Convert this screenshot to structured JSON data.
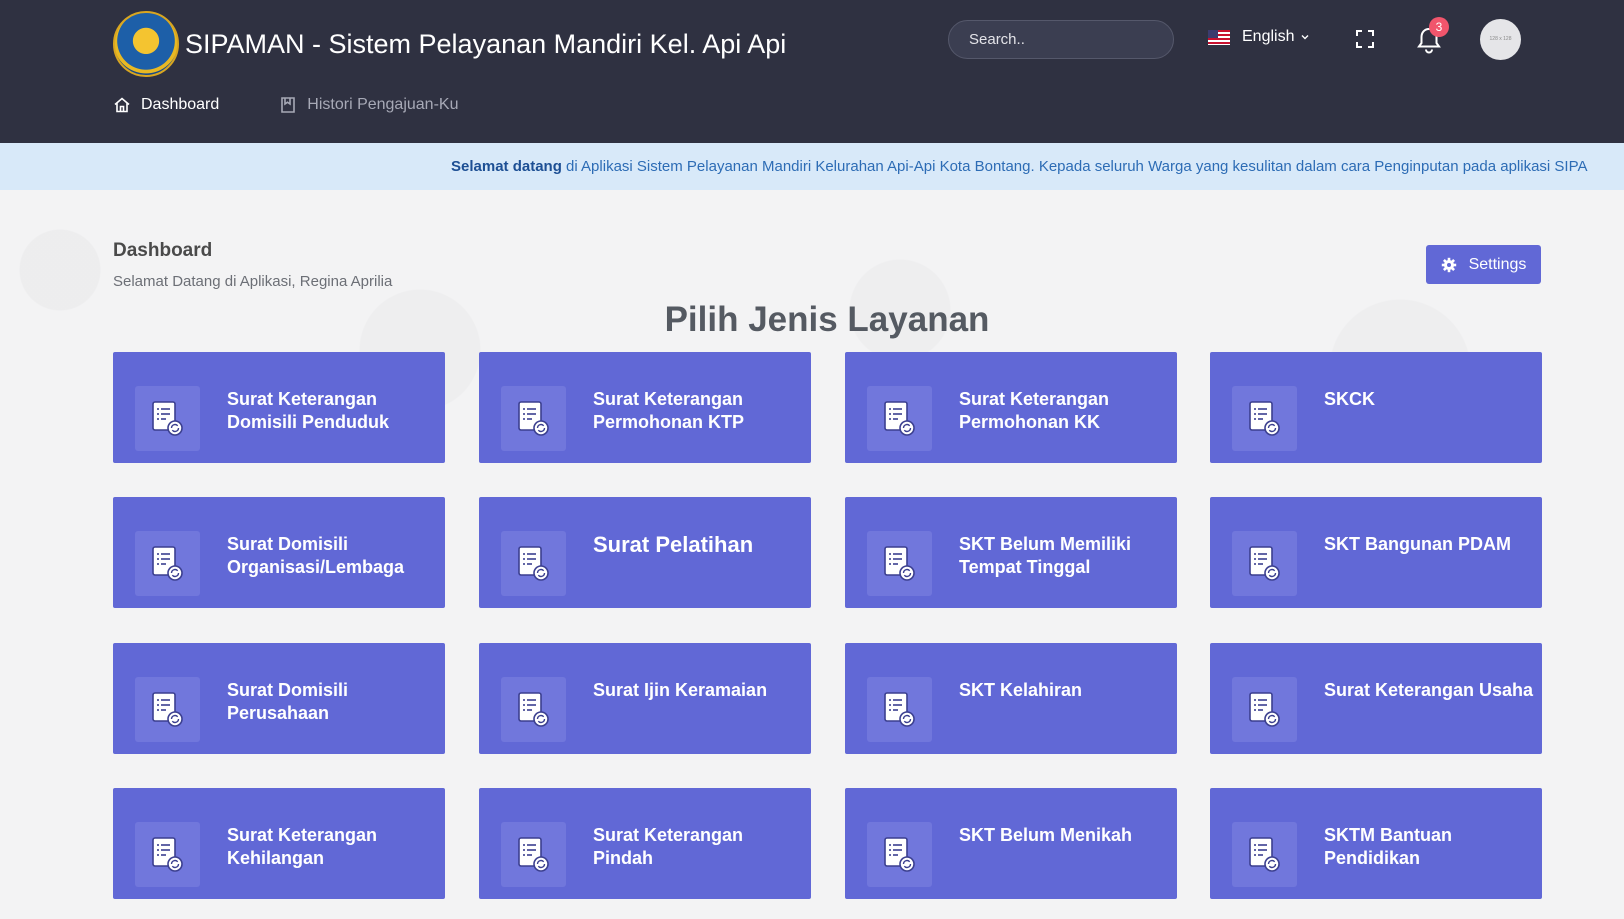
{
  "header": {
    "title": "SIPAMAN - Sistem Pelayanan Mandiri Kel. Api Api",
    "search_placeholder": "Search..",
    "language": "English",
    "notification_count": "3",
    "avatar_text": "128 x 128"
  },
  "nav": {
    "items": [
      {
        "label": "Dashboard",
        "active": true
      },
      {
        "label": "Histori Pengajuan-Ku",
        "active": false
      }
    ]
  },
  "marquee": {
    "lead": "Selamat datang",
    "text": " di Aplikasi Sistem Pelayanan Mandiri Kelurahan Api-Api Kota Bontang. Kepada seluruh Warga yang kesulitan dalam cara Penginputan pada aplikasi SIPA"
  },
  "page": {
    "title": "Dashboard",
    "subtitle": "Selamat Datang di Aplikasi, Regina Aprilia",
    "settings_label": "Settings",
    "section_title": "Pilih Jenis Layanan"
  },
  "services": [
    "Surat Keterangan Domisili Penduduk",
    "Surat Keterangan Permohonan KTP",
    "Surat Keterangan Permohonan KK",
    "SKCK",
    "Surat Domisili Organisasi/Lembaga",
    "Surat Pelatihan",
    "SKT Belum Memiliki Tempat Tinggal",
    "SKT Bangunan PDAM",
    "Surat Domisili Perusahaan",
    "Surat Ijin Keramaian",
    "SKT Kelahiran",
    "Surat Keterangan Usaha",
    "Surat Keterangan Kehilangan",
    "Surat Keterangan Pindah",
    "SKT Belum Menikah",
    "SKTM Bantuan Pendidikan"
  ],
  "colors": {
    "header_bg": "#2f3141",
    "card_bg": "#6168d6",
    "marquee_bg": "#d8e9f9",
    "badge": "#f1556c"
  },
  "icons": {
    "card_icon": "document-refresh-icon",
    "settings_icon": "gear-icon",
    "search_icon": "search-icon",
    "bell_icon": "bell-icon"
  }
}
